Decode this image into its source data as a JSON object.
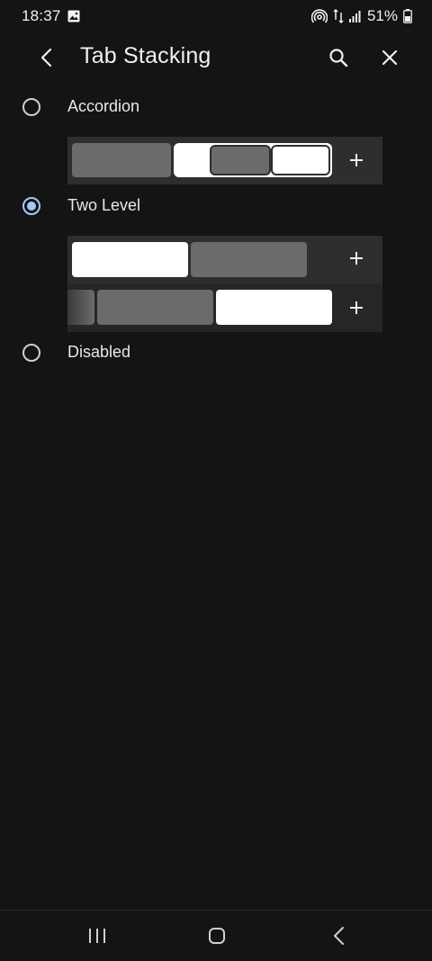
{
  "status_bar": {
    "time": "18:37",
    "battery": "51%",
    "icons": [
      "gallery-icon",
      "hotspot-icon",
      "data-arrows-icon",
      "signal-icon",
      "battery-icon"
    ]
  },
  "header": {
    "title": "Tab Stacking",
    "icons": [
      "back-arrow-icon",
      "search-icon",
      "close-icon"
    ]
  },
  "options": [
    {
      "label": "Accordion",
      "checked": false
    },
    {
      "label": "Two Level",
      "checked": true
    },
    {
      "label": "Disabled",
      "checked": false
    }
  ],
  "colors": {
    "background": "#141414",
    "accent": "#a8c7fa",
    "preview_bg": "#2e2e2e",
    "tab_gray": "#6b6b6b",
    "tab_active": "#ffffff"
  },
  "nav_bar": {
    "icons": [
      "recents-icon",
      "home-icon",
      "back-icon"
    ]
  }
}
